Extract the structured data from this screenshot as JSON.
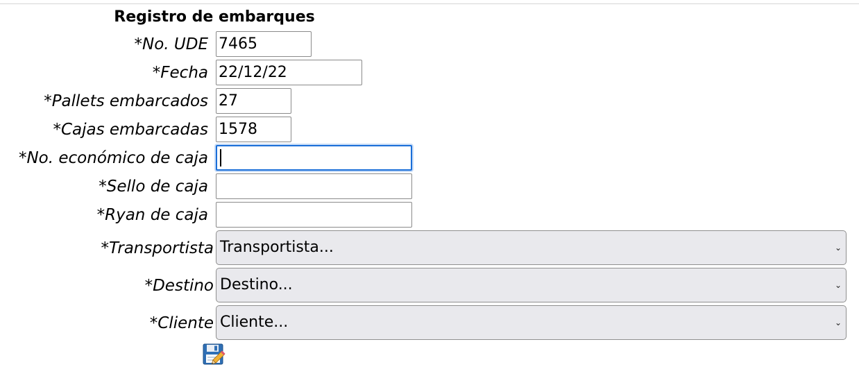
{
  "form": {
    "title": "Registro de embarques",
    "fields": {
      "no_ude": {
        "label": "*No. UDE",
        "value": "7465"
      },
      "fecha": {
        "label": "*Fecha",
        "value": "22/12/22"
      },
      "pallets": {
        "label": "*Pallets embarcados",
        "value": "27"
      },
      "cajas": {
        "label": "*Cajas embarcadas",
        "value": "1578"
      },
      "no_economico": {
        "label": "*No. económico de caja",
        "value": ""
      },
      "sello": {
        "label": "*Sello de caja",
        "value": ""
      },
      "ryan": {
        "label": "*Ryan de caja",
        "value": ""
      }
    },
    "selects": {
      "transportista": {
        "label": "*Transportista",
        "selected": "Transportista..."
      },
      "destino": {
        "label": "*Destino",
        "selected": "Destino..."
      },
      "cliente": {
        "label": "*Cliente",
        "selected": "Cliente..."
      }
    },
    "save_icon": "floppy-disk-pencil-icon"
  }
}
